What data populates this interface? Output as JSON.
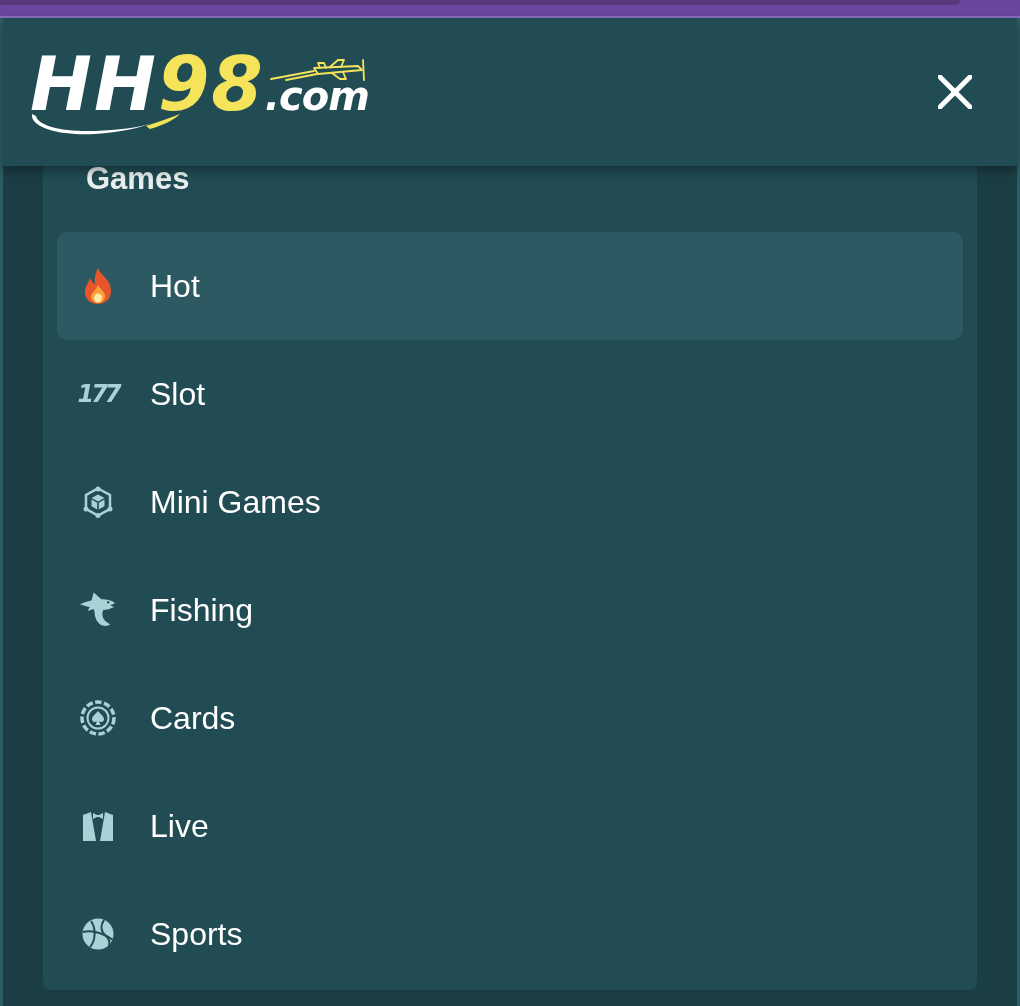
{
  "header": {
    "logo": {
      "parts": [
        {
          "text": "HH",
          "color": "#ffffff"
        },
        {
          "text": "98",
          "color": "#f5e35a"
        },
        {
          "text": ".com",
          "color": "#ffffff"
        }
      ]
    }
  },
  "menu": {
    "title": "Games",
    "items": [
      {
        "label": "Hot",
        "selected": true
      },
      {
        "label": "Slot",
        "selected": false,
        "icon_text": "177"
      },
      {
        "label": "Mini Games",
        "selected": false
      },
      {
        "label": "Fishing",
        "selected": false
      },
      {
        "label": "Cards",
        "selected": false
      },
      {
        "label": "Live",
        "selected": false
      },
      {
        "label": "Sports",
        "selected": false
      }
    ]
  }
}
